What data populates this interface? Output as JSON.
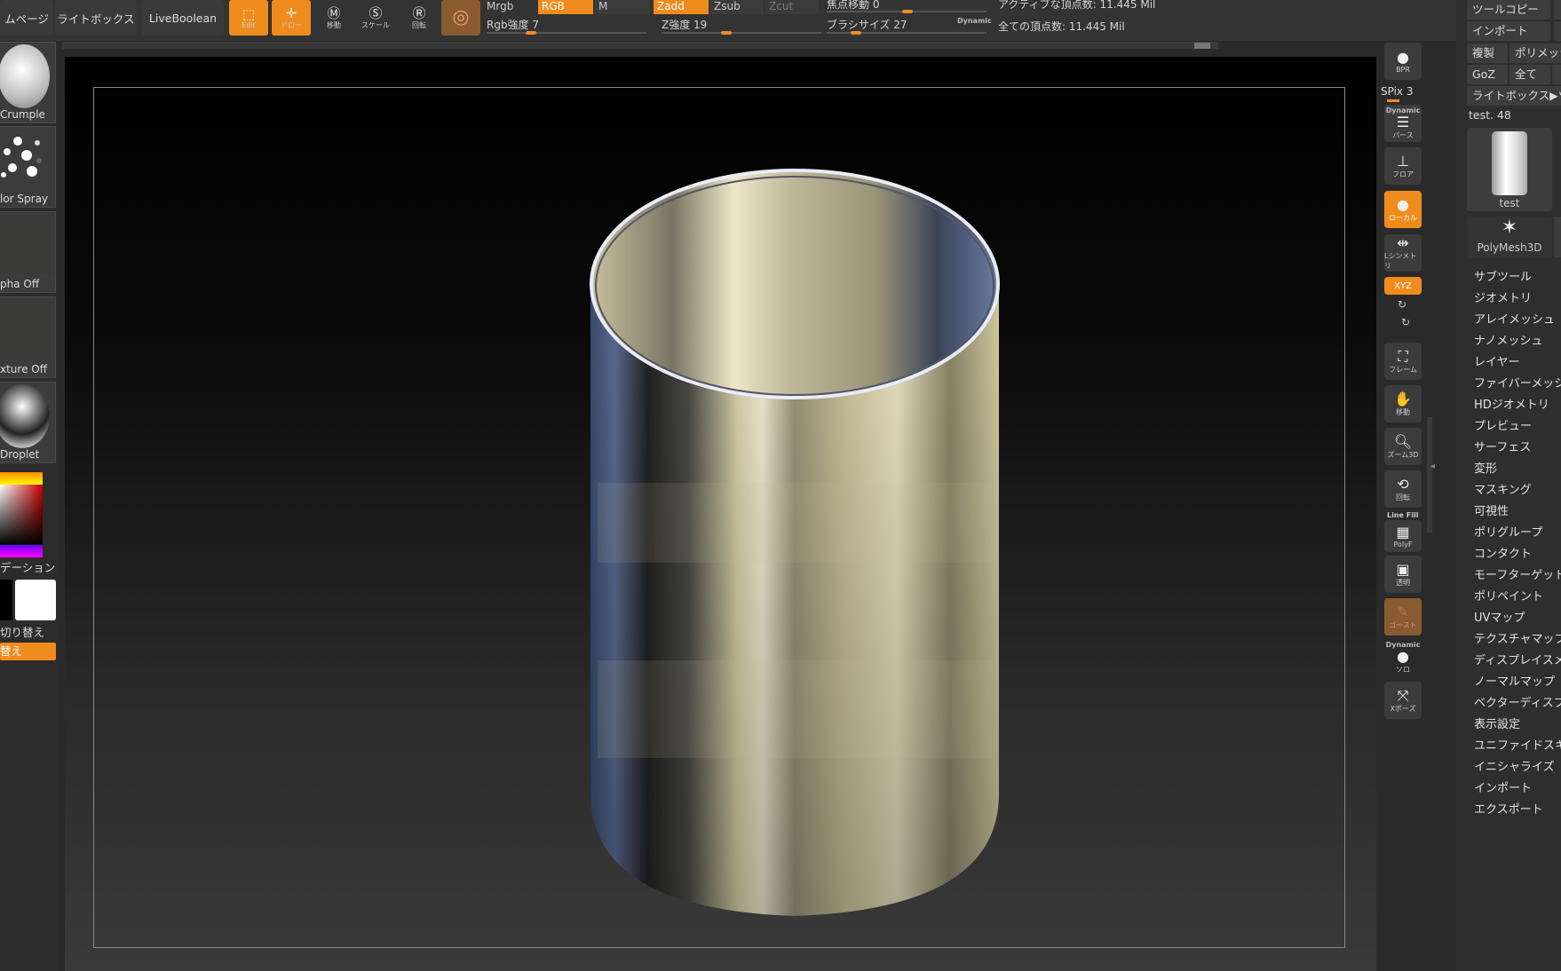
{
  "topbar": {
    "page_tab": "ムページ",
    "lightbox": "ライトボックス",
    "liveboolean": "LiveBoolean",
    "edit": "Edit",
    "draw": "ドロー",
    "move": "移動",
    "scale": "スケール",
    "rotate": "回転",
    "mrgb": "Mrgb",
    "rgb": "RGB",
    "m": "M",
    "zadd": "Zadd",
    "zsub": "Zsub",
    "zcut": "Zcut",
    "rgb_intensity": "Rgb強度 7",
    "z_intensity": "Z強度 19",
    "focal_shift": "焦点移動 0",
    "brush_size": "ブラシサイズ 27",
    "dynamic": "Dynamic",
    "active_points": "アクティブな頂点数: 11.445 Mil",
    "total_points": "全ての頂点数: 11.445 Mil"
  },
  "left": {
    "brush": "Crumple",
    "stroke": "lor Spray",
    "alpha": "pha Off",
    "texture": "xture Off",
    "material": "Droplet",
    "gradient": "デーション",
    "switch_label": "切り替え",
    "switch_btn": "替え"
  },
  "right": {
    "bpr": "BPR",
    "spix": "SPix 3",
    "dynamic": "Dynamic",
    "perspective": "パース",
    "floor": "フロア",
    "local": "ローカル",
    "lsym": "Lシンメトリ",
    "xyz": "XYZ",
    "frame": "フレーム",
    "move": "移動",
    "zoom3d": "ズーム3D",
    "rotate": "回転",
    "linefill": "Line Fill",
    "polyf": "PolyF",
    "transp": "透明",
    "ghost": "ゴースト",
    "solo": "ソロ",
    "xpose": "Xポーズ"
  },
  "toolpanel": {
    "toolcopy": "ツールコピー",
    "import": "インポート",
    "duplicate": "複製",
    "polymesh": "ポリメッシ",
    "goz": "GoZ",
    "all": "全て",
    "lightbox_tool": "ライトボックス▶ツ",
    "tool_name": "test. 48",
    "thumb_label": "test",
    "polymesh3d": "PolyMesh3D",
    "menu": [
      "サブツール",
      "ジオメトリ",
      "アレイメッシュ",
      "ナノメッシュ",
      "レイヤー",
      "ファイバーメッシ",
      "HDジオメトリ",
      "プレビュー",
      "サーフェス",
      "変形",
      "マスキング",
      "可視性",
      "ポリグループ",
      "コンタクト",
      "モーフターゲット",
      "ポリペイント",
      "UVマップ",
      "テクスチャマップ",
      "ディスプレイスメ",
      "ノーマルマップ",
      "ベクターディスプ",
      "表示設定",
      "ユニファイドスキ",
      "イニシャライズ",
      "インポート",
      "エクスポート"
    ]
  }
}
